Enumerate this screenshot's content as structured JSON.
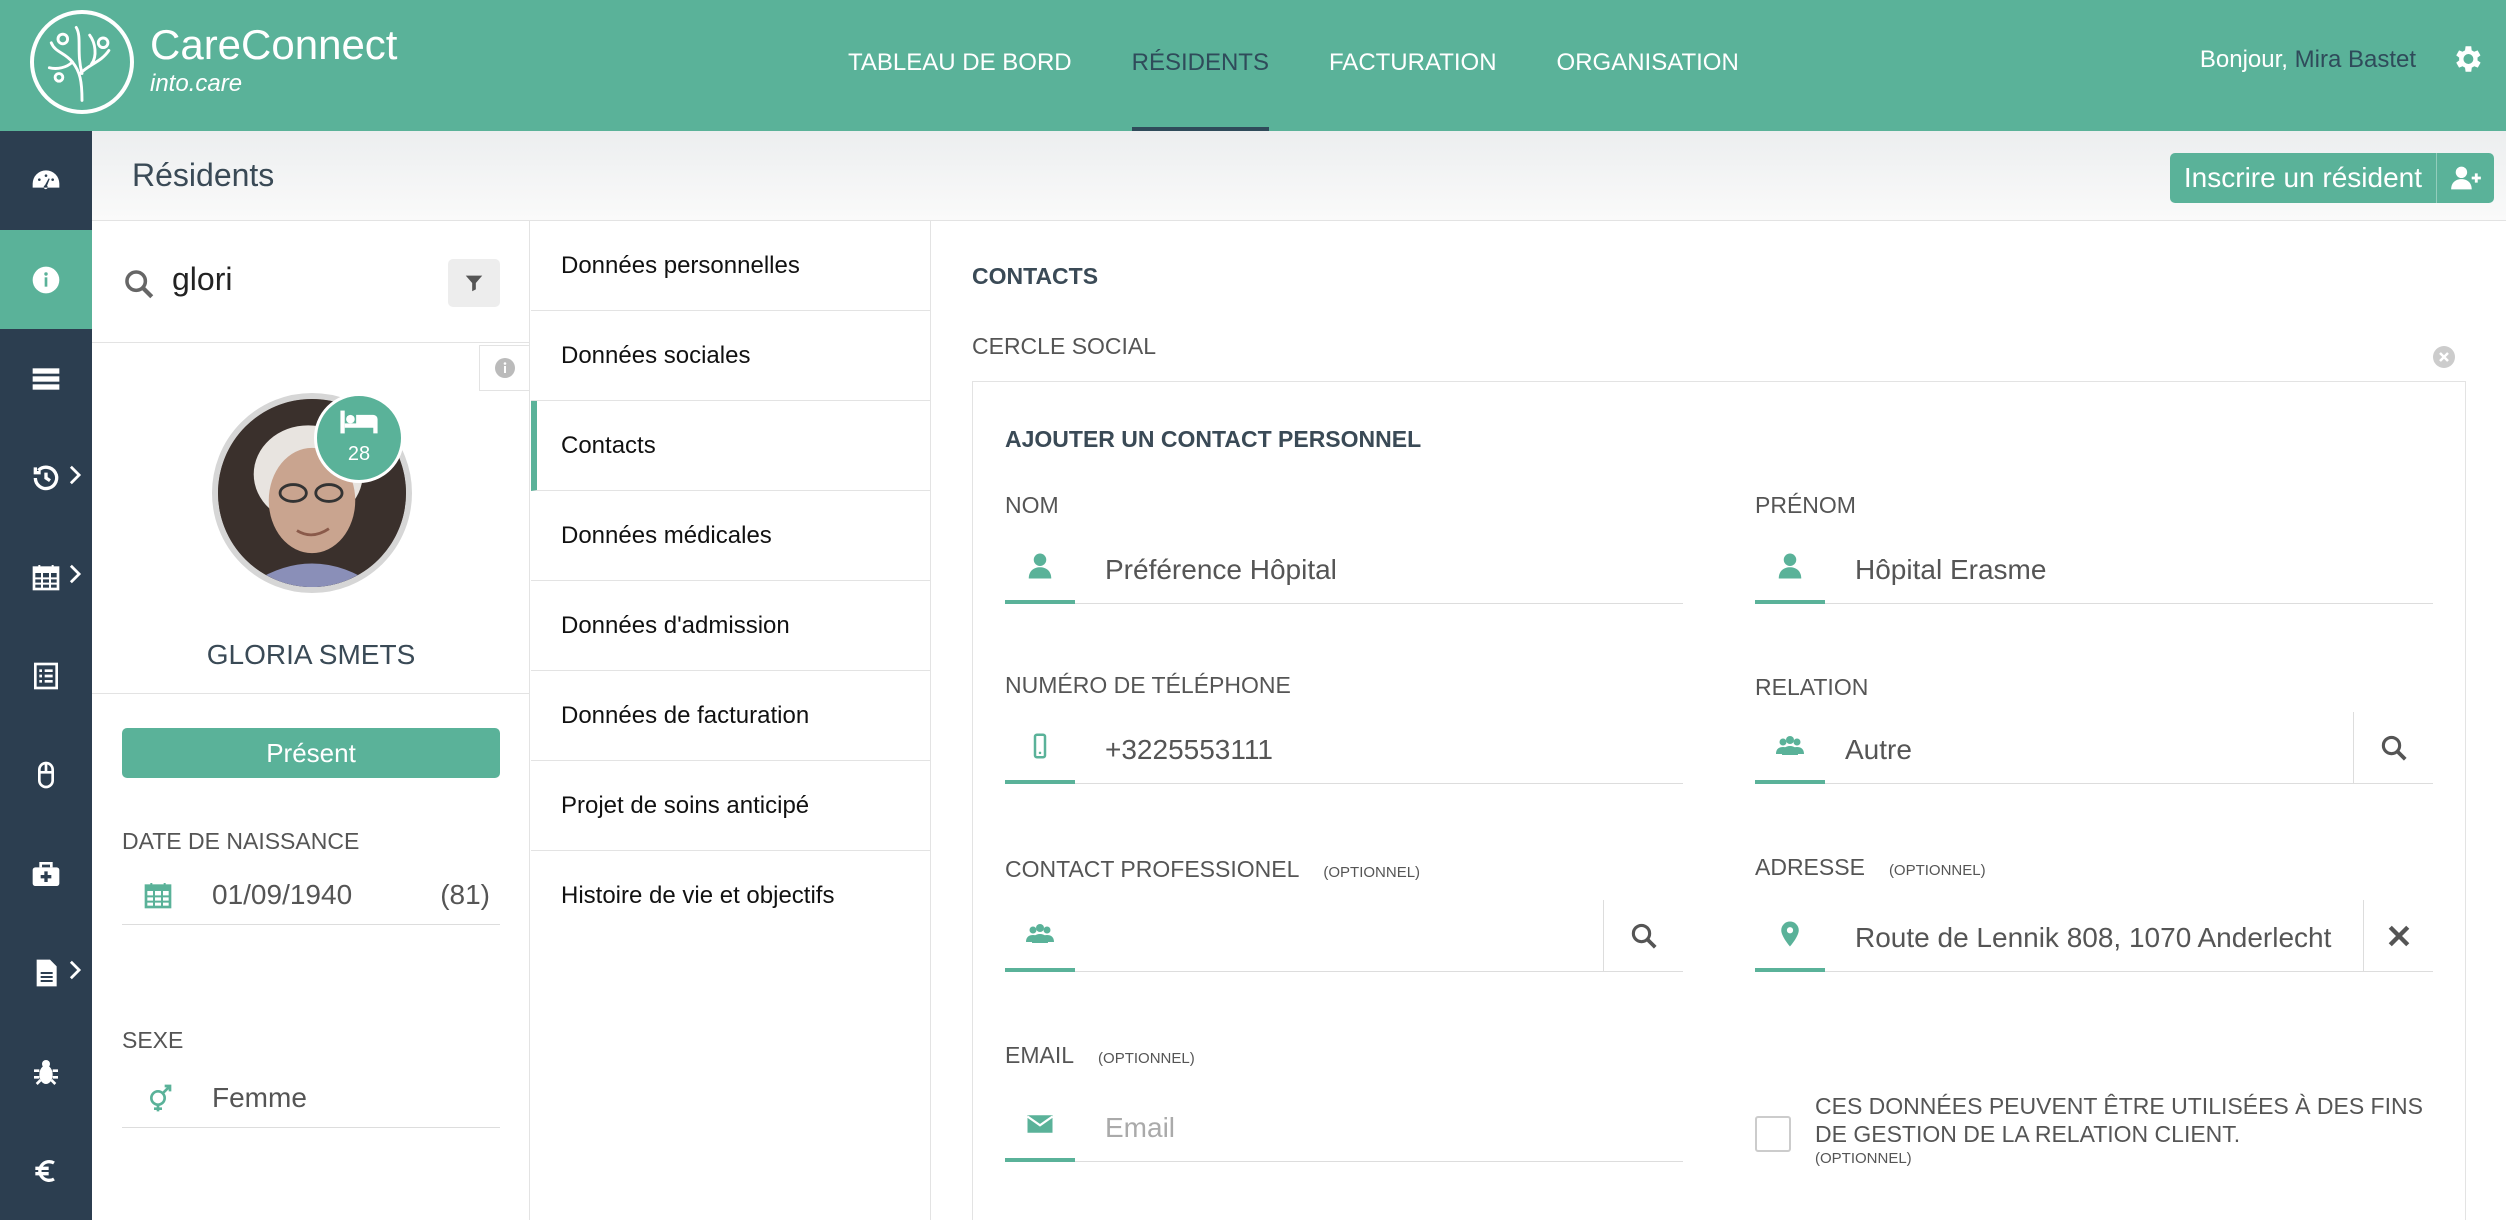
{
  "brand": {
    "name": "CareConnect",
    "sub": "into.care"
  },
  "nav": [
    {
      "label": "TABLEAU DE BORD"
    },
    {
      "label": "RÉSIDENTS"
    },
    {
      "label": "FACTURATION"
    },
    {
      "label": "ORGANISATION"
    }
  ],
  "greeting": {
    "prefix": "Bonjour,",
    "user": "Mira Bastet"
  },
  "page": {
    "title": "Résidents",
    "register_button": "Inscrire un résident"
  },
  "search": {
    "value": "glori"
  },
  "resident": {
    "name": "GLORIA SMETS",
    "bed": "28",
    "status": "Présent",
    "birth_label": "DATE DE NAISSANCE",
    "birth_date": "01/09/1940",
    "age": "(81)",
    "sex_label": "SEXE",
    "sex": "Femme"
  },
  "submenu": [
    {
      "label": "Données personnelles"
    },
    {
      "label": "Données sociales"
    },
    {
      "label": "Contacts"
    },
    {
      "label": "Données médicales"
    },
    {
      "label": "Données d'admission"
    },
    {
      "label": "Données de facturation"
    },
    {
      "label": "Projet de soins anticipé"
    },
    {
      "label": "Histoire de vie et objectifs"
    }
  ],
  "contacts": {
    "title": "CONTACTS",
    "section": "CERCLE SOCIAL",
    "card_title": "AJOUTER UN CONTACT PERSONNEL",
    "nom_label": "NOM",
    "nom_value": "Préférence Hôpital",
    "prenom_label": "PRÉNOM",
    "prenom_value": "Hôpital Erasme",
    "phone_label": "NUMÉRO DE TÉLÉPHONE",
    "phone_value": "+3225553111",
    "relation_label": "RELATION",
    "relation_value": "Autre",
    "pro_label": "CONTACT PROFESSIONEL",
    "optional": "(OPTIONNEL)",
    "address_label": "ADRESSE",
    "address_value": "Route de Lennik 808, 1070 Anderlecht",
    "email_label": "EMAIL",
    "email_placeholder": "Email",
    "consent_text": "CES DONNÉES PEUVENT ÊTRE UTILISÉES À DES FINS DE GESTION DE LA RELATION CLIENT."
  },
  "colors": {
    "accent": "#5ab299",
    "rail": "#2c3e50",
    "active_nav": "#2f4b5a"
  },
  "icons": {
    "rail": [
      "dashboard-icon",
      "info-icon",
      "list-icon",
      "history-icon",
      "calendar-icon",
      "checklist-icon",
      "mouse-icon",
      "medkit-icon",
      "document-icon",
      "bug-icon",
      "euro-icon"
    ]
  }
}
